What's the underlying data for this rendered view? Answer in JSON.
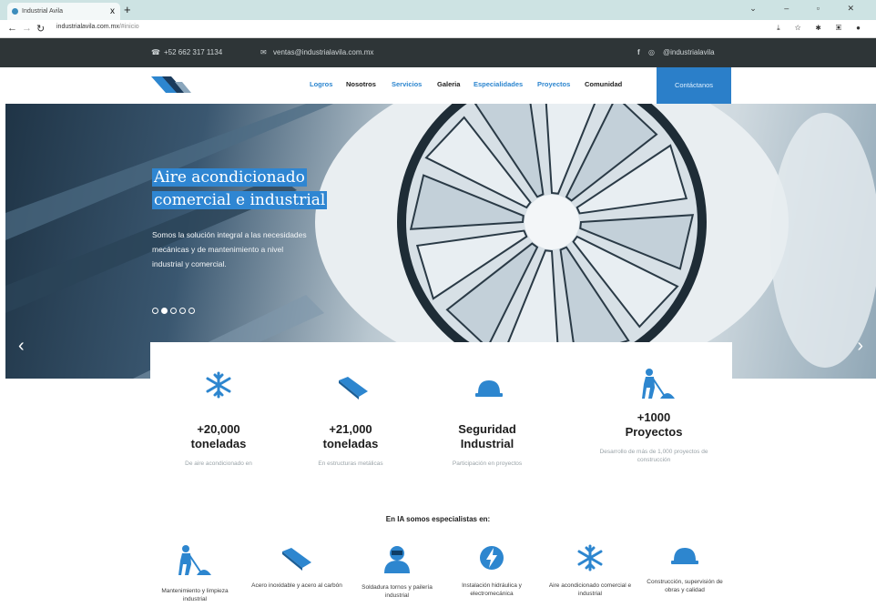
{
  "browser": {
    "tab_title": "Industrial Avila",
    "tab_close": "x",
    "new_tab": "+",
    "url_host": "industrialavila.com.mx",
    "url_path": "/#inicio"
  },
  "topbar": {
    "phone": "+52 662 317 1134",
    "email": "ventas@industrialavila.com.mx",
    "social_handle": "@industrialavila"
  },
  "nav": {
    "items": [
      {
        "label": "Logros",
        "color": "#2d86cf"
      },
      {
        "label": "Nosotros",
        "color": "#1d1d1d"
      },
      {
        "label": "Servicios",
        "color": "#2d86cf"
      },
      {
        "label": "Galeria",
        "color": "#1d1d1d"
      },
      {
        "label": "Especialidades",
        "color": "#2d86cf"
      },
      {
        "label": "Proyectos",
        "color": "#2d86cf"
      },
      {
        "label": "Comunidad",
        "color": "#1d1d1d"
      }
    ],
    "contact_label": "Contáctanos"
  },
  "hero": {
    "title_line1": "Aire acondicionado",
    "title_line2": "comercial e industrial",
    "subtitle": "Somos la solución integral a las necesidades mecánicas y de mantenimiento a nivel industrial y comercial.",
    "slides_total": 5,
    "slide_active": 2,
    "prev": "‹",
    "next": "›"
  },
  "stats": [
    {
      "icon": "snowflake-icon",
      "line1": "+20,000",
      "line2": "toneladas",
      "desc": "De aire acondicionado en"
    },
    {
      "icon": "steel-beam-icon",
      "line1": "+21,000",
      "line2": "toneladas",
      "desc": "En estructuras metálicas"
    },
    {
      "icon": "hard-hat-icon",
      "line1": "Seguridad",
      "line2": "Industrial",
      "desc": "Participación en proyectos"
    },
    {
      "icon": "worker-digging-icon",
      "line1": "+1000",
      "line2": "Proyectos",
      "desc": "Desarrollo de más de 1,000 proyectos de construcción"
    }
  ],
  "specialties": {
    "title": "En IA somos especialistas en:",
    "items": [
      {
        "icon": "worker-digging-icon",
        "label": "Mantenimiento y limpieza industrial"
      },
      {
        "icon": "steel-beam-icon",
        "label": "Acero inoxidable y acero al carbón"
      },
      {
        "icon": "welder-icon",
        "label": "Soldadura tornos y pailería industrial"
      },
      {
        "icon": "lightning-icon",
        "label": "Instalación hidráulica y electromecánica"
      },
      {
        "icon": "snowflake-icon",
        "label": "Aire acondicionado comercial e industrial"
      },
      {
        "icon": "hard-hat-icon",
        "label": "Construcción, supervisión de obras y calidad"
      }
    ]
  },
  "colors": {
    "accent": "#2d86cf",
    "topbar": "#2e3537",
    "contact": "#2b7fc9"
  }
}
